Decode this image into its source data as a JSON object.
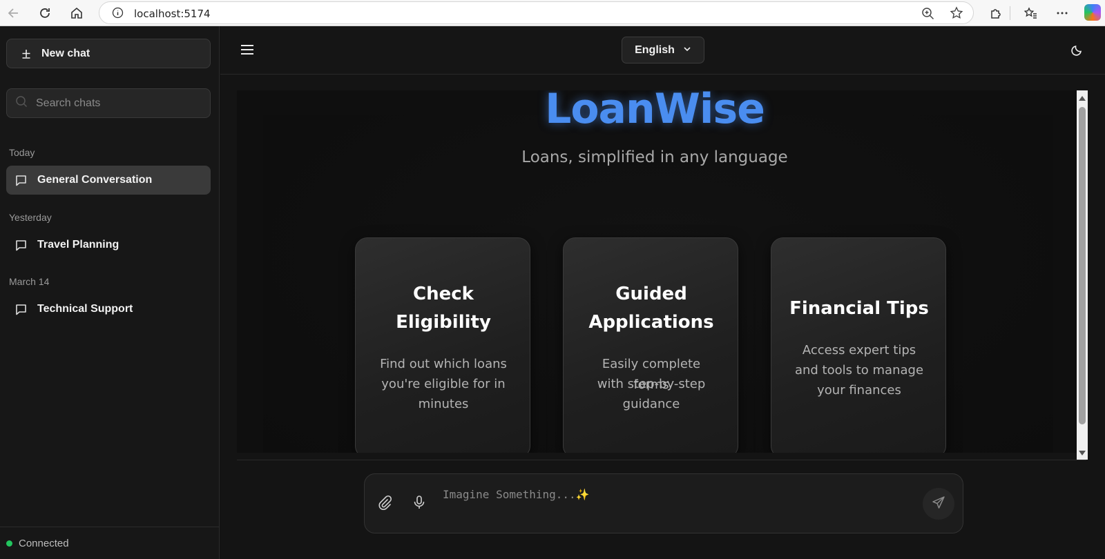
{
  "browser": {
    "url": "localhost:5174",
    "icons": [
      "back-icon",
      "refresh-icon",
      "home-icon",
      "info-icon",
      "zoom-icon",
      "favorite-star-icon",
      "extensions-icon",
      "favorites-icon",
      "more-icon",
      "copilot-icon"
    ]
  },
  "sidebar": {
    "new_chat_label": "New chat",
    "search_placeholder": "Search chats",
    "groups": [
      {
        "label": "Today",
        "items": [
          {
            "label": "General Conversation",
            "active": true
          }
        ]
      },
      {
        "label": "Yesterday",
        "items": [
          {
            "label": "Travel Planning",
            "active": false
          }
        ]
      },
      {
        "label": "March 14",
        "items": [
          {
            "label": "Technical Support",
            "active": false
          }
        ]
      }
    ],
    "status": "Connected",
    "status_color": "#22c55e"
  },
  "header": {
    "language": "English"
  },
  "hero": {
    "brand": "LoanWise",
    "brand_color": "#4a8df0",
    "tagline": "Loans, simplified in any language"
  },
  "cards": [
    {
      "title_lines": [
        "Check",
        "Eligibility"
      ],
      "desc_lines": [
        "Find out which loans",
        "you're eligible for in",
        "minutes"
      ]
    },
    {
      "title_lines": [
        "Guided",
        "Applications"
      ],
      "desc_lines": [
        "Easily complete forms",
        "with step-by-step",
        "guidance"
      ]
    },
    {
      "title_lines": [
        "Financial Tips"
      ],
      "desc_lines": [
        "Access expert tips",
        "and tools to manage",
        "your finances"
      ]
    }
  ],
  "composer": {
    "placeholder": "Imagine Something...✨"
  }
}
